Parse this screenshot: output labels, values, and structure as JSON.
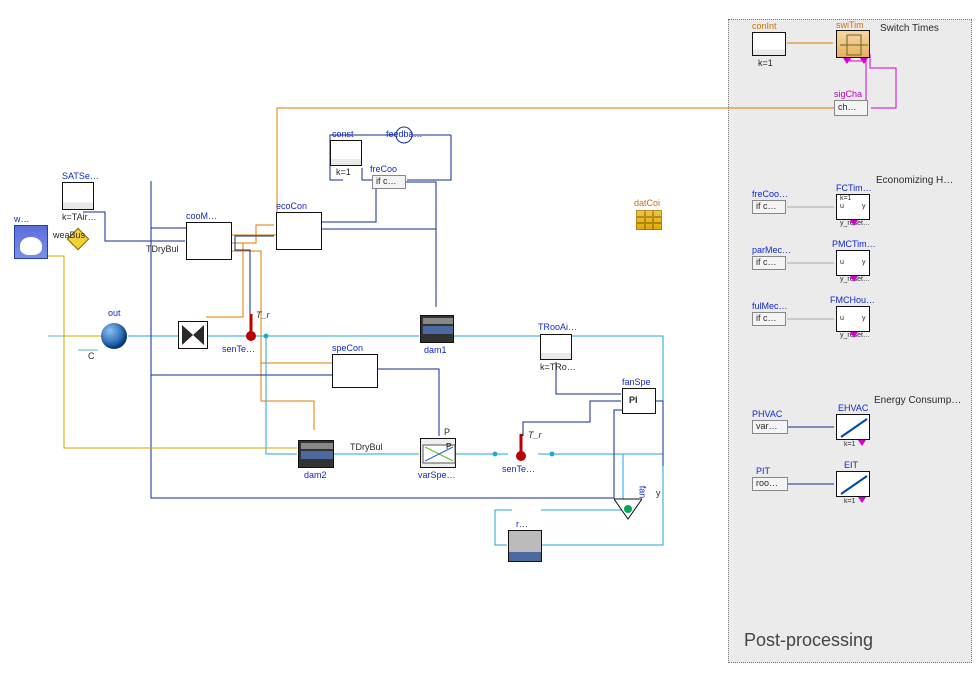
{
  "panel": {
    "title": "Post-processing",
    "sectionSwitch": "Switch Times",
    "sectionEcon": "Economizing H…",
    "sectionEnergy": "Energy Consump…"
  },
  "blocks": {
    "w": {
      "label": "w…",
      "sub": ""
    },
    "weaBus": {
      "label": "weaBus"
    },
    "SATSe": {
      "label": "SATSe…",
      "sub": "k=TAir…"
    },
    "TDryBul": "TDryBul",
    "TDryBul2": "TDryBul",
    "out": {
      "label": "out",
      "sub": "C"
    },
    "cooM": {
      "label": "cooM…"
    },
    "ecoCon": {
      "label": "ecoCon"
    },
    "const": {
      "label": "const",
      "sub": "k=1"
    },
    "feedba": {
      "label": "feedba…"
    },
    "freCoo": {
      "label": "freCoo",
      "sub": "if c…"
    },
    "senTe1": {
      "label": "senTe…"
    },
    "Tr1": "T_r",
    "damper": {
      "iconOnly": true
    },
    "dam1": {
      "label": "dam1"
    },
    "dam2": {
      "label": "dam2"
    },
    "speCon": {
      "label": "speCon"
    },
    "TRooAi": {
      "label": "TRooAi…",
      "sub": "k=TRo…"
    },
    "fanSpe": {
      "label": "fanSpe",
      "inner": "PI"
    },
    "varSpe": {
      "label": "varSpe…",
      "inner": "P"
    },
    "senTe2": {
      "label": "senTe…"
    },
    "Tr2": "T_r",
    "fan": {
      "label": "fan"
    },
    "y": "y",
    "r": {
      "label": "r…"
    },
    "datCoi": {
      "label": "datCoi"
    },
    "swiTim": {
      "label": "swiTim"
    },
    "conInt": {
      "label": "conInt",
      "sub": "k=1"
    },
    "sigCha": {
      "label": "sigCha",
      "sub": "ch…"
    },
    "freCoo2": {
      "label": "freCoo…",
      "sub": "if c…"
    },
    "FCTim": {
      "label": "FCTim…",
      "sub": "k=1",
      "u": "u",
      "y": "y",
      "reset": "y_reset…"
    },
    "parMec": {
      "label": "parMec…",
      "sub": "if c…"
    },
    "PMCTim": {
      "label": "PMCTim…",
      "sub": "",
      "u": "u",
      "y": "y",
      "reset": "y_reset…"
    },
    "fulMec": {
      "label": "fulMec…",
      "sub": "if c…"
    },
    "FMCHou": {
      "label": "FMCHou…",
      "sub": "",
      "u": "u",
      "y": "y",
      "reset": "y_reset…"
    },
    "PHVAC": {
      "label": "PHVAC",
      "sub": "var…"
    },
    "EHVAC": {
      "label": "EHVAC",
      "sub": "k=1"
    },
    "PIT": {
      "label": "PIT",
      "sub": "roo…"
    },
    "EIT": {
      "label": "EIT",
      "sub": "k=1"
    }
  }
}
